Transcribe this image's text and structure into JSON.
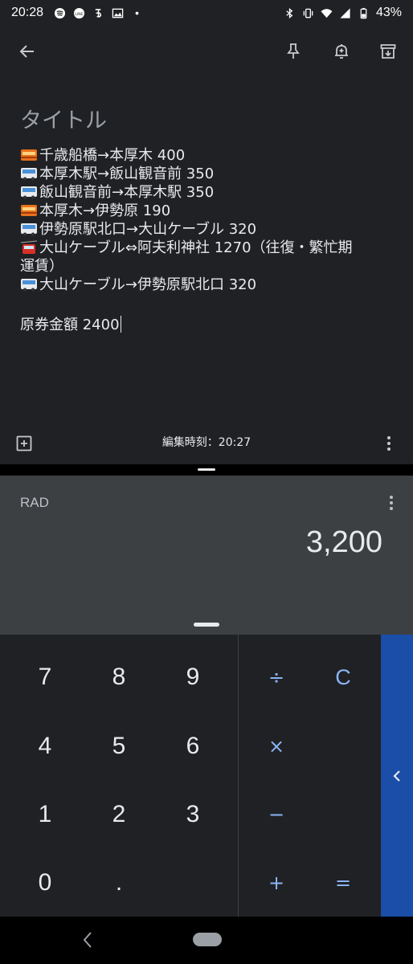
{
  "status_bar": {
    "time": "20:28",
    "app_icons": [
      "spotify-icon",
      "line-icon",
      "bus-app-icon",
      "photo-icon",
      "dot-icon"
    ],
    "system_icons": [
      "bluetooth-icon",
      "vibrate-icon",
      "wifi-icon",
      "signal-icon",
      "battery-icon"
    ],
    "battery": "43%"
  },
  "keep": {
    "toolbar": {
      "back_icon": "arrow-back-icon",
      "pin_icon": "pin-icon",
      "reminder_icon": "reminder-bell-icon",
      "archive_icon": "archive-icon"
    },
    "title_placeholder": "タイトル",
    "note_lines": [
      {
        "icon": "train-icon",
        "text": "千歳船橋→本厚木 400"
      },
      {
        "icon": "bus-icon",
        "text": "本厚木駅→飯山観音前 350"
      },
      {
        "icon": "bus-icon",
        "text": "飯山観音前→本厚木駅 350"
      },
      {
        "icon": "train-icon",
        "text": "本厚木→伊勢原 190"
      },
      {
        "icon": "bus-icon",
        "text": "伊勢原駅北口→大山ケーブル 320"
      },
      {
        "icon": "cable-car-icon",
        "text": "大山ケーブル⇔阿夫利神社 1270（往復・繁忙期"
      },
      {
        "icon": "",
        "text": "運賃）"
      },
      {
        "icon": "bus-icon",
        "text": "大山ケーブル→伊勢原駅北口 320"
      }
    ],
    "total_line": "原券金額 2400",
    "edit_time": "編集時刻：20:27",
    "add_icon": "add-box-icon",
    "more_icon": "more-vert-icon"
  },
  "calculator": {
    "mode": "RAD",
    "result": "3,200",
    "more_icon": "more-vert-icon",
    "digits": [
      {
        "label": "7"
      },
      {
        "label": "8"
      },
      {
        "label": "9"
      },
      {
        "label": "4"
      },
      {
        "label": "5"
      },
      {
        "label": "6"
      },
      {
        "label": "1"
      },
      {
        "label": "2"
      },
      {
        "label": "3"
      },
      {
        "label": "0"
      },
      {
        "label": "."
      }
    ],
    "operators": [
      {
        "label": "÷"
      },
      {
        "label": "C"
      },
      {
        "label": "×"
      },
      {
        "label": ""
      },
      {
        "label": "−"
      },
      {
        "label": ""
      },
      {
        "label": "+"
      },
      {
        "label": "="
      }
    ],
    "advanced_icon": "chevron-left-icon"
  },
  "colors": {
    "keep_bg": "#202124",
    "display_bg": "#3c4043",
    "accent": "#8ab4f8",
    "advanced_panel": "#1a4ea8"
  }
}
